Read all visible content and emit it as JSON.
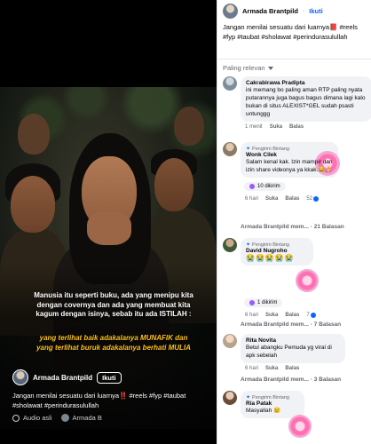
{
  "video": {
    "quote_line1": "Manusia itu seperti buku, ada yang menipu kita dengan covernya dan ada yang membuat kita kagum dengan isinya, sebab itu ada ISTILAH :",
    "quote_line2": "yang terlihat baik adakalanya MUNAFIK dan yang terlihat buruk adakalanya berhati MULIA",
    "author": "Armada Brantpild",
    "follow": "Ikuti",
    "caption": "Jangan menilai sesuatu dari luarnya‼️ #reels #fyp #taubat #sholawat #perindurasulullah",
    "audio": "Audio asli",
    "audio_author": "Armada B"
  },
  "post": {
    "author": "Armada Brantpild",
    "dot": "·",
    "follow": "Ikuti",
    "caption": "Jangan menilai sesuatu dari luarnya📕 #reels #fyp #taubat #sholawat #perindurasulullah"
  },
  "sort_label": "Paling relevan",
  "comments": [
    {
      "name": "Cakrabirawa Pradipta",
      "text": "ini memang bo paling aman RTP paling nyata putarannya juga bagus bagus dimana lagi kalo bukan di situs ALEXIST*GEL sudah psasti untunggg",
      "time": "1 menit",
      "like": "Suka",
      "reply": "Balas"
    },
    {
      "badge": "Pengirim Bintang",
      "name": "Wonk Cilek",
      "text": "Salam kenal kak. Izin mampir dan izin share videonya ya kkak.😂🙏",
      "gift": "10 dikirim",
      "time": "6 hari",
      "like": "Suka",
      "reply": "Balas",
      "count": "52"
    },
    {
      "badge": "Pengirim Bintang",
      "name": "David Nugroho",
      "text": "😭😭😭😭😭",
      "gift": "1 dikirim",
      "time": "6 hari",
      "like": "Suka",
      "reply": "Balas",
      "count": "7"
    },
    {
      "name": "Rita Novita",
      "text": "Betul abangku Pemuda yg viral di apk sebelah",
      "time": "6 hari",
      "like": "Suka",
      "reply": "Balas"
    },
    {
      "badge": "Pengirim Bintang",
      "name": "Ria Patak",
      "text": "Masyallah 😢",
      "time": ""
    }
  ],
  "replies": [
    "Armada Brantpild mem... · 21 Balasan",
    "Armada Brantpild mem... · 7 Balasan",
    "Armada Brantpild mem... · 3 Balasan"
  ],
  "colors": {
    "accent": "#0866ff",
    "quote_highlight": "#ffc21a"
  }
}
